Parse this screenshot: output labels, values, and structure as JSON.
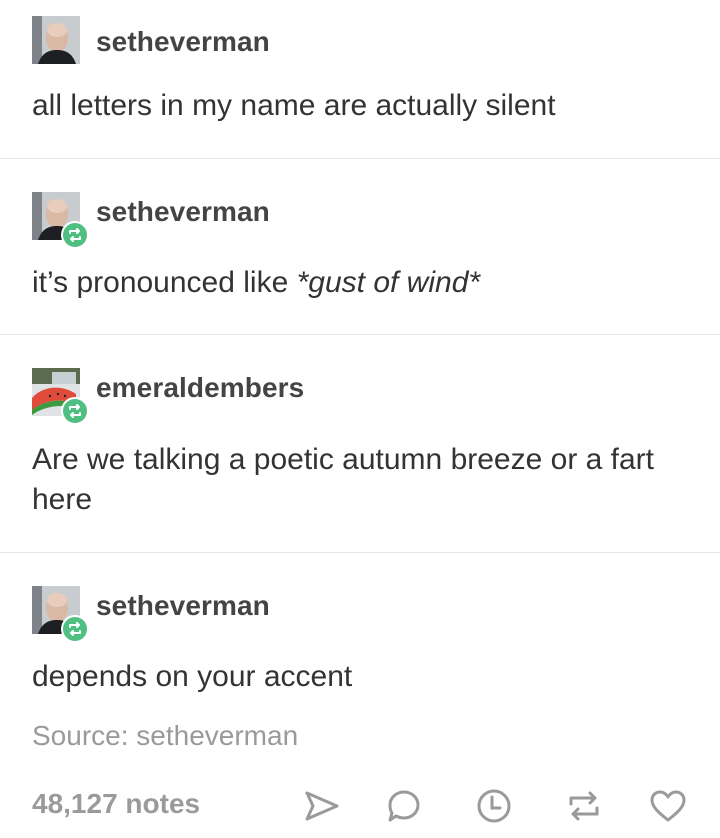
{
  "posts": [
    {
      "username": "setheverman",
      "avatar_icon": "bald-man-avatar",
      "reblog": false,
      "text": "all letters in my name are actually silent"
    },
    {
      "username": "setheverman",
      "avatar_icon": "bald-man-avatar",
      "reblog": true,
      "text_plain": "it’s pronounced like ",
      "text_italic": "*gust of wind*"
    },
    {
      "username": "emeraldembers",
      "avatar_icon": "watermelon-avatar",
      "reblog": true,
      "text": "Are we talking a poetic autumn breeze or a fart here"
    },
    {
      "username": "setheverman",
      "avatar_icon": "bald-man-avatar",
      "reblog": true,
      "text": "depends on your accent"
    }
  ],
  "source": "Source: setheverman",
  "footer": {
    "notes": "48,127 notes",
    "actions": [
      "share-icon",
      "comment-icon",
      "clock-icon",
      "reblog-icon",
      "heart-icon"
    ]
  },
  "colors": {
    "reblog_badge": "#4fc082",
    "text": "#333333",
    "muted": "#9a9a9a",
    "icon": "#9a9a9a"
  }
}
